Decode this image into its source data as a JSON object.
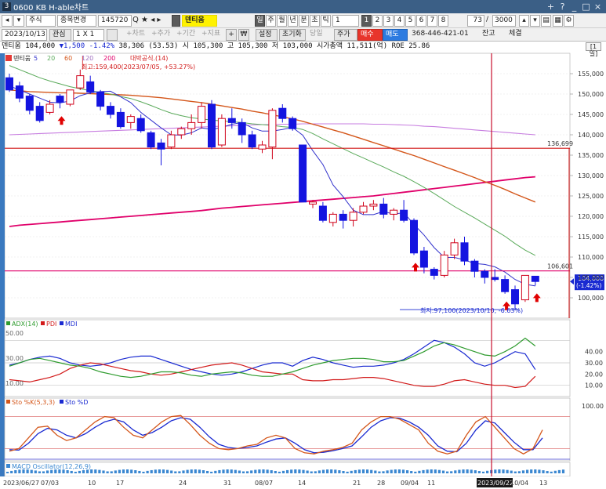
{
  "window": {
    "title": "0600 KB H-able차트",
    "code_num": "3",
    "buttons": [
      "+",
      "?",
      "_",
      "□",
      "×"
    ]
  },
  "toolbar1": {
    "market": "주식",
    "mode": "종목변경",
    "code": "145720",
    "stock_name": "덴티움",
    "tabs": [
      "일",
      "주",
      "월",
      "년",
      "분",
      "초",
      "틱"
    ],
    "period_count": "1",
    "nums": [
      "1",
      "2",
      "3",
      "4",
      "5",
      "6",
      "7",
      "8"
    ],
    "zoom_value": "73",
    "zoom_max": "3000"
  },
  "toolbar2": {
    "date": "2023/10/13",
    "interest": "관심",
    "ratio": "1 X 1",
    "links": [
      "+차트",
      "+추가",
      "+기간",
      "+지표"
    ],
    "setting": "설정",
    "reset": "초기화",
    "same_day": "당일",
    "price": "주가",
    "buy": "매수",
    "sell": "매도",
    "account": "368-446-421-01",
    "balance": "잔고",
    "executed": "체결"
  },
  "info": {
    "name": "덴티움",
    "price": "104,000",
    "change": "▼1,500",
    "pct": "-1.42%",
    "volume": "38,306 (53.53)",
    "open": "시 105,300",
    "high": "고 105,300",
    "low": "저 103,000",
    "market_cap": "시가총액 11,511(억)",
    "roe": "ROE 25.86",
    "period": "[1일]"
  },
  "colors": {
    "up": "#d0021b",
    "down": "#1414e0",
    "ma5": "#3333cc",
    "ma20": "#5aaa5a",
    "ma60": "#d4561a",
    "ma120": "#c77de0",
    "ma200": "#e0006a",
    "adx": "#2e9b2e",
    "pdi": "#d21a1a",
    "mdi": "#1a2ad1",
    "sto_k": "#d4561a",
    "sto_d": "#1a2ad1",
    "macd": "#3a87d1",
    "guide_line": "#d21a1a",
    "selected_bg": "#ffffff"
  },
  "price_chart": {
    "legend": {
      "title": "덴티움",
      "mas": [
        "5",
        "20",
        "60",
        "120",
        "200"
      ],
      "pattern": "대박공식.(14)"
    },
    "ylim": [
      95000,
      160000
    ],
    "y_ticks": [
      100000,
      105000,
      110000,
      115000,
      120000,
      125000,
      130000,
      135000,
      140000,
      145000,
      150000,
      155000
    ],
    "y_tick_labels": [
      "100,000",
      "105,000",
      "110,000",
      "115,000",
      "120,000",
      "125,000",
      "130,000",
      "135,000",
      "140,000",
      "145,000",
      "150,000",
      "155,000"
    ],
    "h_lines": [
      {
        "value": 136699,
        "label": "136,699"
      },
      {
        "value": 106601,
        "label": "106,601"
      }
    ],
    "price_tag": {
      "value": 104000,
      "label": "104,000",
      "pct": "(-1.42%)"
    },
    "annot_high": "최고:159,400(2023/07/05, +53.27%)",
    "annot_low": "최저:97,100(2023/10/10, -6.63%)",
    "candles": [
      {
        "o": 154000,
        "h": 155000,
        "c": 151000,
        "l": 150500
      },
      {
        "o": 152000,
        "h": 153000,
        "c": 149000,
        "l": 148000
      },
      {
        "o": 149500,
        "h": 150000,
        "c": 146000,
        "l": 145000
      },
      {
        "o": 147000,
        "h": 148000,
        "c": 143500,
        "l": 143000
      },
      {
        "o": 145500,
        "h": 148500,
        "c": 147500,
        "l": 145000
      },
      {
        "o": 149500,
        "h": 150000,
        "c": 148000,
        "l": 146500
      },
      {
        "o": 147500,
        "h": 151000,
        "c": 151000,
        "l": 147000
      },
      {
        "o": 151500,
        "h": 156000,
        "c": 154500,
        "l": 151000
      },
      {
        "o": 153000,
        "h": 154500,
        "c": 150500,
        "l": 150000
      },
      {
        "o": 150500,
        "h": 151000,
        "c": 147000,
        "l": 146000
      },
      {
        "o": 147000,
        "h": 148000,
        "c": 145000,
        "l": 144000
      },
      {
        "o": 145500,
        "h": 146500,
        "c": 142000,
        "l": 141500
      },
      {
        "o": 143000,
        "h": 145000,
        "c": 144500,
        "l": 141500
      },
      {
        "o": 144000,
        "h": 145000,
        "c": 141000,
        "l": 140500
      },
      {
        "o": 140500,
        "h": 141000,
        "c": 137000,
        "l": 136500
      },
      {
        "o": 138000,
        "h": 139000,
        "c": 136500,
        "l": 132500
      },
      {
        "o": 137000,
        "h": 141000,
        "c": 140000,
        "l": 136500
      },
      {
        "o": 140000,
        "h": 142000,
        "c": 141500,
        "l": 139000
      },
      {
        "o": 141500,
        "h": 145000,
        "c": 143000,
        "l": 140000
      },
      {
        "o": 143000,
        "h": 148000,
        "c": 147000,
        "l": 141500
      },
      {
        "o": 147500,
        "h": 148500,
        "c": 137000,
        "l": 136500
      },
      {
        "o": 137500,
        "h": 145000,
        "c": 144000,
        "l": 137000
      },
      {
        "o": 144000,
        "h": 146500,
        "c": 143000,
        "l": 141500
      },
      {
        "o": 143000,
        "h": 144000,
        "c": 140000,
        "l": 138000
      },
      {
        "o": 140000,
        "h": 141000,
        "c": 137000,
        "l": 136500
      },
      {
        "o": 136500,
        "h": 138500,
        "c": 137500,
        "l": 135500
      },
      {
        "o": 137000,
        "h": 146500,
        "c": 146000,
        "l": 134000
      },
      {
        "o": 146500,
        "h": 147500,
        "c": 144000,
        "l": 143000
      },
      {
        "o": 144000,
        "h": 144500,
        "c": 141500,
        "l": 141000
      },
      {
        "o": 137500,
        "h": 137500,
        "c": 123500,
        "l": 123500
      },
      {
        "o": 123000,
        "h": 124000,
        "c": 123500,
        "l": 122000
      },
      {
        "o": 122500,
        "h": 123500,
        "c": 119000,
        "l": 118500
      },
      {
        "o": 118500,
        "h": 121000,
        "c": 120500,
        "l": 117500
      },
      {
        "o": 120500,
        "h": 121500,
        "c": 119000,
        "l": 117000
      },
      {
        "o": 119000,
        "h": 122000,
        "c": 121000,
        "l": 117500
      },
      {
        "o": 121000,
        "h": 123500,
        "c": 122500,
        "l": 120500
      },
      {
        "o": 122500,
        "h": 124000,
        "c": 123000,
        "l": 121500
      },
      {
        "o": 123000,
        "h": 124500,
        "c": 120500,
        "l": 119500
      },
      {
        "o": 120500,
        "h": 122000,
        "c": 121500,
        "l": 119000
      },
      {
        "o": 121500,
        "h": 124000,
        "c": 119000,
        "l": 118500
      },
      {
        "o": 119000,
        "h": 119500,
        "c": 111000,
        "l": 110500
      },
      {
        "o": 111500,
        "h": 112500,
        "c": 107500,
        "l": 106000
      },
      {
        "o": 107000,
        "h": 107500,
        "c": 105500,
        "l": 104500
      },
      {
        "o": 105500,
        "h": 111500,
        "c": 110500,
        "l": 105000
      },
      {
        "o": 110500,
        "h": 114500,
        "c": 113500,
        "l": 109500
      },
      {
        "o": 113500,
        "h": 115000,
        "c": 109000,
        "l": 108000
      },
      {
        "o": 109000,
        "h": 109500,
        "c": 106500,
        "l": 105000
      },
      {
        "o": 106500,
        "h": 107000,
        "c": 105000,
        "l": 103500
      },
      {
        "o": 105000,
        "h": 107000,
        "c": 104500,
        "l": 104000
      },
      {
        "o": 104500,
        "h": 105500,
        "c": 101500,
        "l": 101000
      },
      {
        "o": 102000,
        "h": 103000,
        "c": 98500,
        "l": 97100
      },
      {
        "o": 99500,
        "h": 105000,
        "c": 105500,
        "l": 99000
      },
      {
        "o": 105300,
        "h": 105300,
        "c": 104000,
        "l": 103000
      }
    ],
    "ma5": [
      152000,
      151000,
      150000,
      149000,
      148000,
      147800,
      148300,
      149600,
      150300,
      150600,
      150700,
      149300,
      147900,
      145500,
      143600,
      141700,
      140000,
      139900,
      140500,
      141700,
      141300,
      141800,
      142600,
      143000,
      141700,
      140900,
      140900,
      141300,
      141800,
      139900,
      136100,
      132700,
      127700,
      124800,
      121500,
      120400,
      120400,
      121200,
      120500,
      120900,
      118000,
      115400,
      112300,
      109900,
      109900,
      109300,
      108400,
      108200,
      107600,
      106300,
      104500,
      103300,
      102900
    ],
    "ma20": [
      157000,
      156000,
      155000,
      154000,
      153200,
      152500,
      151800,
      151300,
      150800,
      150400,
      150000,
      149400,
      148900,
      148100,
      147200,
      146200,
      145300,
      144700,
      144200,
      143900,
      143600,
      143400,
      143200,
      143000,
      142700,
      142500,
      142300,
      142000,
      141800,
      141300,
      140300,
      139000,
      137800,
      136600,
      135400,
      134300,
      133200,
      132100,
      130900,
      129800,
      128500,
      127100,
      125600,
      124000,
      122400,
      121000,
      119600,
      118100,
      116600,
      115100,
      113300,
      111700,
      110400
    ],
    "ma60": [
      151000,
      150800,
      150600,
      150500,
      150400,
      150300,
      150300,
      150200,
      150100,
      150000,
      149900,
      149800,
      149700,
      149500,
      149300,
      149100,
      148800,
      148500,
      148200,
      147900,
      147500,
      147100,
      146700,
      146300,
      145800,
      145400,
      144900,
      144400,
      143900,
      143300,
      142600,
      141900,
      141200,
      140500,
      139700,
      138900,
      138100,
      137300,
      136500,
      135700,
      134900,
      134000,
      133100,
      132200,
      131300,
      130400,
      129500,
      128500,
      127600,
      126600,
      125500,
      124500,
      123500
    ],
    "ma120": [
      140000,
      140100,
      140200,
      140300,
      140400,
      140500,
      140600,
      140700,
      140800,
      140900,
      141000,
      141100,
      141200,
      141300,
      141400,
      141500,
      141600,
      141700,
      141800,
      141900,
      142000,
      142100,
      142200,
      142300,
      142400,
      142500,
      142500,
      142600,
      142600,
      142700,
      142700,
      142700,
      142700,
      142700,
      142700,
      142700,
      142600,
      142600,
      142500,
      142400,
      142300,
      142100,
      142000,
      141800,
      141600,
      141400,
      141200,
      141000,
      140800,
      140600,
      140400,
      140200,
      140000
    ],
    "ma200": [
      117500,
      117800,
      118000,
      118200,
      118400,
      118600,
      118800,
      119000,
      119200,
      119400,
      119600,
      119800,
      120000,
      120200,
      120400,
      120600,
      120800,
      121000,
      121200,
      121400,
      121700,
      122000,
      122200,
      122400,
      122600,
      122800,
      123000,
      123200,
      123400,
      123600,
      123800,
      124000,
      124200,
      124400,
      124600,
      124800,
      125000,
      125300,
      125600,
      125900,
      126200,
      126500,
      126800,
      127100,
      127400,
      127700,
      128000,
      128300,
      128600,
      128900,
      129200,
      129500,
      129700
    ],
    "arrows_idx": [
      5,
      40,
      49,
      52
    ]
  },
  "adx_panel": {
    "legend": [
      "ADX(14)",
      "PDI",
      "MDI"
    ],
    "ylim": [
      0,
      60
    ],
    "ref_lines": [
      50,
      30,
      10
    ],
    "ref_labels": [
      "50.00",
      "30.00",
      "10.00"
    ],
    "y_tick_labels": [
      "40.00",
      "30.00",
      "20.00",
      "10.00"
    ],
    "y_ticks": [
      40,
      30,
      20,
      10
    ],
    "adx": [
      27,
      30,
      33,
      34,
      32,
      30,
      28,
      27,
      25,
      22,
      20,
      18,
      17,
      18,
      20,
      22,
      22,
      21,
      19,
      18,
      20,
      21,
      22,
      21,
      19,
      18,
      18,
      20,
      22,
      25,
      28,
      30,
      32,
      33,
      34,
      34,
      33,
      31,
      31,
      32,
      36,
      40,
      45,
      48,
      46,
      43,
      40,
      37,
      36,
      40,
      45,
      52,
      45
    ],
    "pdi": [
      15,
      14,
      13,
      15,
      17,
      20,
      25,
      28,
      30,
      29,
      27,
      25,
      23,
      22,
      20,
      19,
      20,
      22,
      24,
      26,
      28,
      29,
      30,
      28,
      25,
      22,
      21,
      20,
      20,
      15,
      14,
      14,
      15,
      15,
      16,
      17,
      17,
      16,
      14,
      12,
      10,
      9,
      9,
      11,
      14,
      15,
      13,
      11,
      10,
      10,
      8,
      9,
      18
    ],
    "mdi": [
      28,
      30,
      33,
      35,
      36,
      34,
      30,
      28,
      27,
      28,
      30,
      33,
      35,
      36,
      36,
      33,
      30,
      27,
      24,
      22,
      20,
      19,
      20,
      22,
      25,
      28,
      30,
      30,
      27,
      32,
      35,
      33,
      30,
      28,
      26,
      27,
      27,
      28,
      30,
      33,
      38,
      44,
      50,
      48,
      44,
      38,
      30,
      27,
      30,
      35,
      40,
      38,
      24
    ]
  },
  "sto_panel": {
    "legend": [
      "Sto %K(5,3,3)",
      "Sto %D"
    ],
    "ylim": [
      0,
      100
    ],
    "ref_lines": [
      80,
      20
    ],
    "y_tick_labels": [
      "100.00"
    ],
    "y_ticks": [
      100
    ],
    "k": [
      15,
      20,
      40,
      60,
      62,
      45,
      35,
      40,
      55,
      70,
      80,
      78,
      60,
      45,
      40,
      55,
      70,
      80,
      82,
      65,
      45,
      30,
      20,
      18,
      20,
      25,
      28,
      40,
      45,
      40,
      20,
      12,
      10,
      15,
      18,
      22,
      30,
      55,
      70,
      80,
      80,
      75,
      65,
      55,
      30,
      15,
      10,
      15,
      45,
      70,
      80,
      60,
      40,
      20,
      10,
      20,
      55
    ],
    "d": [
      18,
      17,
      30,
      48,
      58,
      55,
      45,
      40,
      48,
      60,
      70,
      75,
      70,
      55,
      45,
      50,
      60,
      72,
      78,
      75,
      60,
      42,
      28,
      22,
      20,
      22,
      25,
      32,
      38,
      40,
      30,
      18,
      12,
      13,
      16,
      20,
      25,
      42,
      60,
      72,
      78,
      77,
      70,
      60,
      45,
      25,
      15,
      14,
      30,
      55,
      72,
      68,
      50,
      32,
      18,
      18,
      40
    ]
  },
  "macd_panel": {
    "legend": [
      "MACD Oscillator(12,26,9)"
    ]
  },
  "x_axis": {
    "labels": [
      "2023/06/27",
      "07/03",
      "10",
      "17",
      "24",
      "31",
      "08/07",
      "14",
      "21",
      "28",
      "09/04",
      "11",
      "2023/09/22",
      "10/04",
      "13"
    ],
    "label_idx": [
      0,
      3.5,
      8,
      13,
      18,
      23,
      28,
      32.5,
      38.5,
      43,
      47.5,
      51.5,
      54.5,
      58.5,
      63
    ]
  },
  "cursor": {
    "date_label": "2023/09/22"
  }
}
